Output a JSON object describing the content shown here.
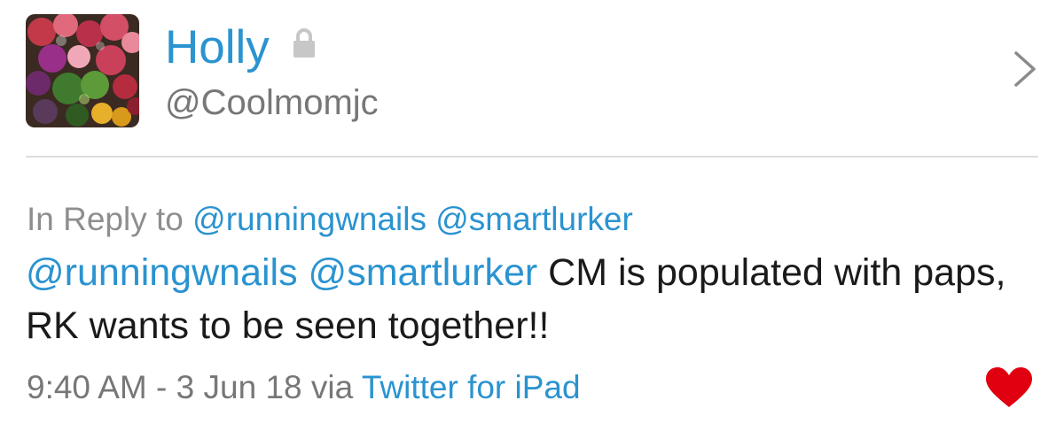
{
  "profile": {
    "display_name": "Holly",
    "handle": "@Coolmomjc",
    "avatar_icon": "flower-bouquet-photo",
    "protected_icon": "lock-icon",
    "link_icon": "chevron-right-icon"
  },
  "reply": {
    "prefix": "In Reply to",
    "mentions": [
      "@runningwnails",
      "@smartlurker"
    ]
  },
  "tweet": {
    "mentions": [
      "@runningwnails",
      "@smartlurker"
    ],
    "text": "CM is populated with paps, RK wants to be seen together!!"
  },
  "meta": {
    "time": "9:40 AM",
    "separator": "-",
    "date": "3 Jun 18",
    "via": "via",
    "client": "Twitter for iPad"
  },
  "actions": {
    "like_icon": "heart-icon",
    "like_color": "#e0000f"
  },
  "colors": {
    "link_blue": "#2a93d0",
    "secondary_gray": "#777777",
    "divider": "#dedede"
  }
}
